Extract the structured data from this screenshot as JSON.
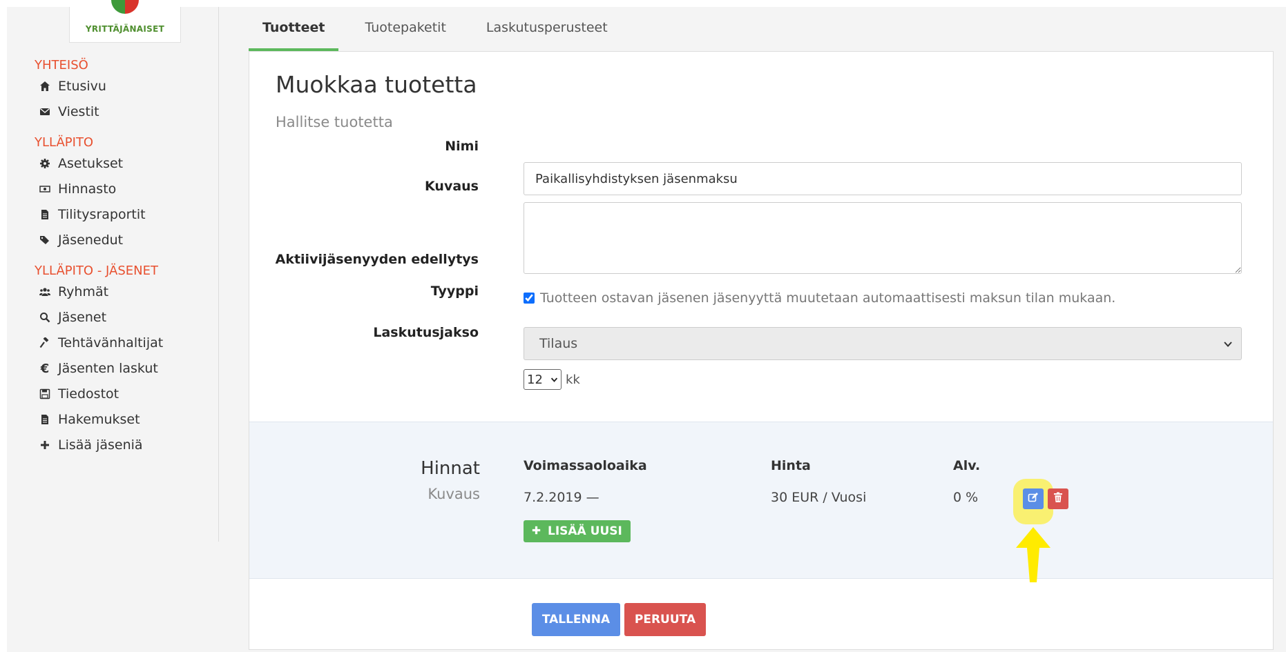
{
  "sidebar": {
    "logo_text": "YRITTÄJÄNAISET",
    "sections": [
      {
        "title": "YHTEISÖ",
        "items": [
          {
            "label": "Etusivu",
            "icon": "home-icon"
          },
          {
            "label": "Viestit",
            "icon": "envelope-icon"
          }
        ]
      },
      {
        "title": "YLLÄPITO",
        "items": [
          {
            "label": "Asetukset",
            "icon": "gear-icon"
          },
          {
            "label": "Hinnasto",
            "icon": "money-bill-icon"
          },
          {
            "label": "Tilitysraportit",
            "icon": "file-icon"
          },
          {
            "label": "Jäsenedut",
            "icon": "tags-icon"
          }
        ]
      },
      {
        "title": "YLLÄPITO - JÄSENET",
        "items": [
          {
            "label": "Ryhmät",
            "icon": "users-icon"
          },
          {
            "label": "Jäsenet",
            "icon": "search-icon"
          },
          {
            "label": "Tehtävänhaltijat",
            "icon": "gavel-icon"
          },
          {
            "label": "Jäsenten laskut",
            "icon": "euro-icon"
          },
          {
            "label": "Tiedostot",
            "icon": "save-icon"
          },
          {
            "label": "Hakemukset",
            "icon": "file-icon"
          },
          {
            "label": "Lisää jäseniä",
            "icon": "plus-icon"
          }
        ]
      }
    ]
  },
  "tabs": [
    {
      "label": "Tuotteet",
      "active": true
    },
    {
      "label": "Tuotepaketit",
      "active": false
    },
    {
      "label": "Laskutusperusteet",
      "active": false
    }
  ],
  "form": {
    "title": "Muokkaa tuotetta",
    "subtitle": "Hallitse tuotetta",
    "name_label": "Nimi",
    "name_value": "Paikallisyhdistyksen jäsenmaksu",
    "description_label": "Kuvaus",
    "description_value": "",
    "active_label": "Aktiivijäsenyyden edellytys",
    "active_checked": true,
    "active_text": "Tuotteen ostavan jäsenen jäsenyyttä muutetaan automaattisesti maksun tilan mukaan.",
    "type_label": "Tyyppi",
    "type_value": "Tilaus",
    "period_label": "Laskutusjakso",
    "period_value": "12",
    "period_unit": "kk"
  },
  "prices": {
    "title": "Hinnat",
    "subtitle": "Kuvaus",
    "columns": {
      "validity": "Voimassaoloaika",
      "price": "Hinta",
      "vat": "Alv."
    },
    "rows": [
      {
        "validity": "7.2.2019 —",
        "price": "30 EUR / Vuosi",
        "vat": "0 %"
      }
    ],
    "add_label": "LISÄÄ UUSI"
  },
  "actions": {
    "save_label": "TALLENNA",
    "cancel_label": "PERUUTA"
  },
  "colors": {
    "accent_green": "#5cb85c",
    "primary_blue": "#5b8ee6",
    "danger_red": "#d9534f",
    "section_orange": "#e8502f",
    "highlight_yellow": "#ffeb00"
  }
}
